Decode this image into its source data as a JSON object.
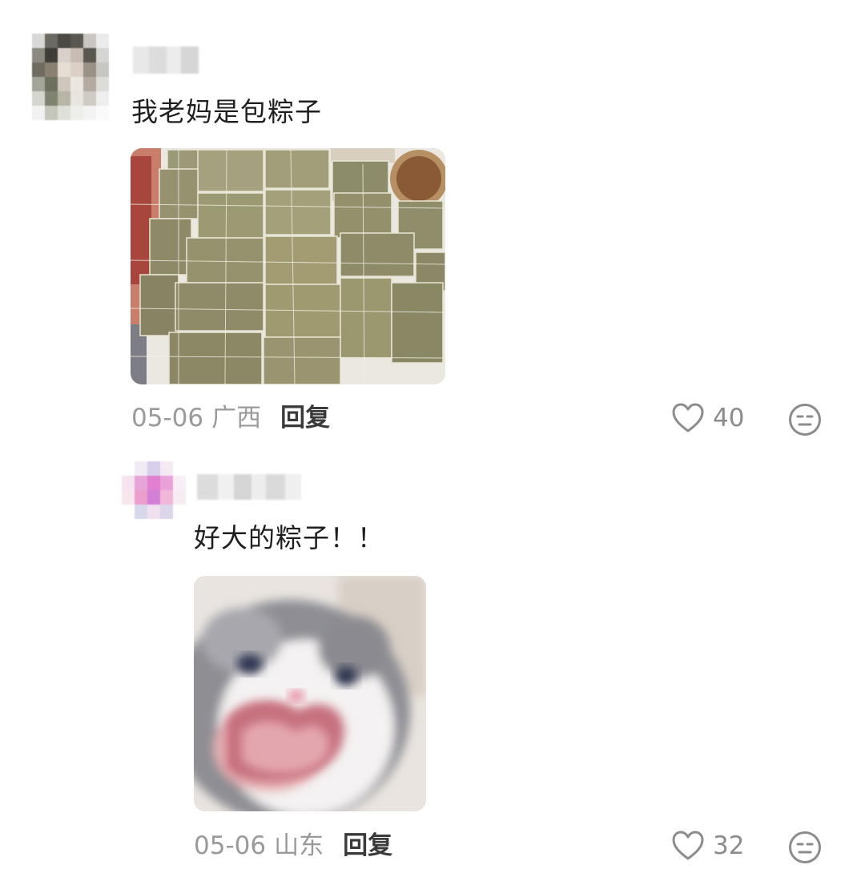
{
  "comments": [
    {
      "text": "我老妈是包粽子",
      "date": "05-06",
      "location": "广西",
      "reply_label": "回复",
      "likes": "40",
      "image_icon": "zongzi-photo"
    },
    {
      "text": "好大的粽子！！",
      "date": "05-06",
      "location": "山东",
      "reply_label": "回复",
      "likes": "32",
      "image_icon": "cat-meme-photo"
    }
  ],
  "colors": {
    "meta": "#9a9a9a",
    "reply": "#3a3a3a",
    "icon": "#8c8c8c"
  }
}
